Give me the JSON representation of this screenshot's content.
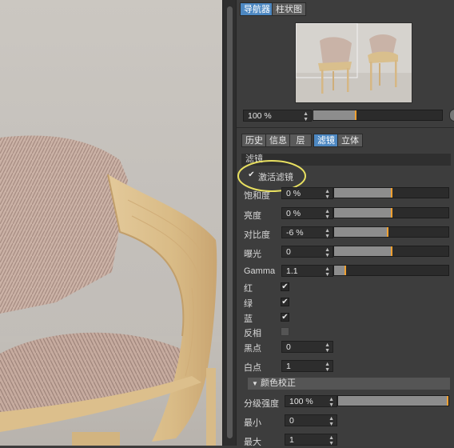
{
  "navigator": {
    "tabs": [
      {
        "label": "导航器",
        "active": true
      },
      {
        "label": "柱状图",
        "active": false
      }
    ],
    "zoom_value": "100 %",
    "zoom_slider_fraction": 0.32
  },
  "attributes": {
    "tabs": [
      {
        "label": "历史",
        "active": false
      },
      {
        "label": "信息",
        "active": false
      },
      {
        "label": "层",
        "active": false
      },
      {
        "label": "滤镜",
        "active": true
      },
      {
        "label": "立体",
        "active": false
      }
    ],
    "section_title": "滤镜",
    "activate_filter": {
      "label": "激活滤镜",
      "checked": true
    },
    "params": [
      {
        "label": "饱和度",
        "value": "0 %",
        "slider_fraction": 0.5
      },
      {
        "label": "亮度",
        "value": "0 %",
        "slider_fraction": 0.5
      },
      {
        "label": "对比度",
        "value": "-6 %",
        "slider_fraction": 0.47
      },
      {
        "label": "曝光",
        "value": "0",
        "slider_fraction": 0.5
      },
      {
        "label": "Gamma",
        "value": "1.1",
        "slider_fraction": 0.1
      }
    ],
    "channels": [
      {
        "label": "红",
        "checked": true
      },
      {
        "label": "绿",
        "checked": true
      },
      {
        "label": "蓝",
        "checked": true
      },
      {
        "label": "反相",
        "checked": false
      }
    ],
    "black_point": {
      "label": "黑点",
      "value": "0"
    },
    "white_point": {
      "label": "白点",
      "value": "1"
    },
    "color_correction": {
      "title": "颜色校正",
      "strength": {
        "label": "分级强度",
        "value": "100 %",
        "slider_fraction": 1.0
      },
      "min": {
        "label": "最小",
        "value": "0"
      },
      "max": {
        "label": "最大",
        "value": "1"
      }
    }
  },
  "colors": {
    "active_tab": "#4d88c2",
    "slider_marker": "#f0a030",
    "highlight_circle": "#e8e060"
  }
}
